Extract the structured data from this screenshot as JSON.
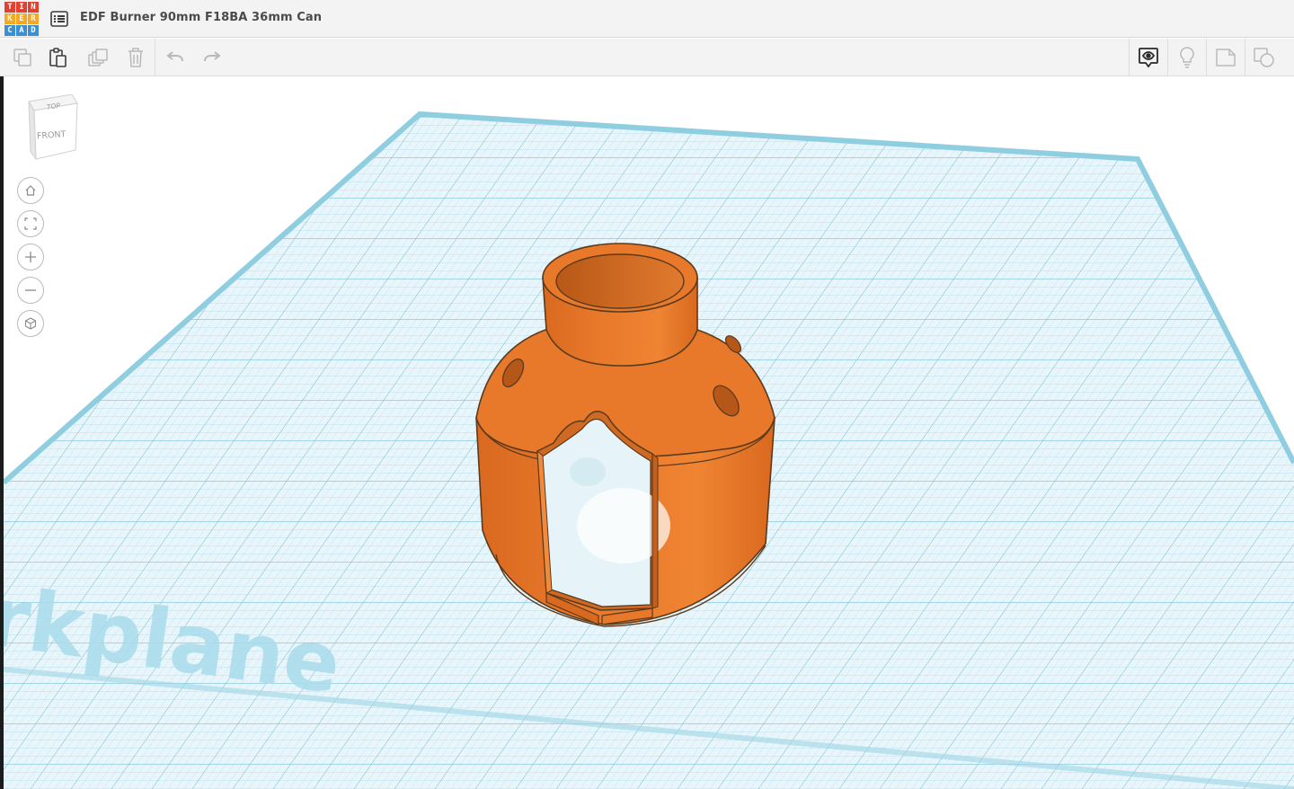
{
  "app": {
    "logo_letters": [
      "T",
      "I",
      "N",
      "K",
      "E",
      "R",
      "C",
      "A",
      "D"
    ],
    "logo_colors": [
      "#e2412f",
      "#e2412f",
      "#e2412f",
      "#f7a823",
      "#f7a823",
      "#f7a823",
      "#3c8fd0",
      "#3c8fd0",
      "#3c8fd0"
    ],
    "design_title": "EDF Burner 90mm F18BA 36mm Can"
  },
  "toolbar": {
    "left_tools": [
      {
        "name": "copy-icon"
      },
      {
        "name": "paste-icon"
      },
      {
        "name": "duplicate-icon"
      },
      {
        "name": "delete-icon"
      },
      {
        "name": "undo-icon"
      },
      {
        "name": "redo-icon"
      }
    ],
    "right_tools": [
      {
        "name": "show-hide-icon"
      },
      {
        "name": "lightbulb-icon"
      },
      {
        "name": "note-icon"
      },
      {
        "name": "group-icon"
      }
    ]
  },
  "viewport": {
    "viewcube": {
      "top_label": "TOP",
      "front_label": "FRONT"
    },
    "nav_buttons": [
      "home-icon",
      "fit-view-icon",
      "zoom-in-icon",
      "zoom-out-icon",
      "perspective-icon"
    ],
    "workplane_watermark": "rkplane",
    "grid_color": "#7fc4dc",
    "shape_color": "#e8782a"
  }
}
